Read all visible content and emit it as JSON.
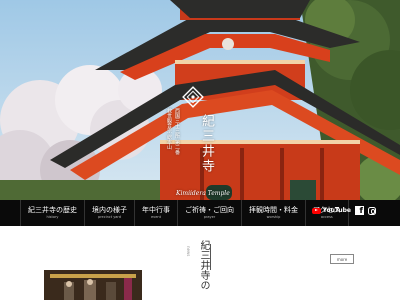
{
  "site": {
    "name": "紀三井寺",
    "romaji": "Kimiidera Temple",
    "tagline_1": "西国三十三所 第二番",
    "tagline_2": "救世観音宗 総本山"
  },
  "nav": {
    "items": [
      {
        "label": "紀三井寺の歴史",
        "en": "history"
      },
      {
        "label": "境内の様子",
        "en": "precinct yard"
      },
      {
        "label": "年中行事",
        "en": "event"
      },
      {
        "label": "ご祈祷・ご回向",
        "en": "prayer"
      },
      {
        "label": "拝観時間・料金",
        "en": "worship"
      },
      {
        "label": "アクセス",
        "en": "access"
      }
    ]
  },
  "social": {
    "youtube_label": "YouTube",
    "facebook_glyph": "f",
    "youtube_color": "#ff0000"
  },
  "section": {
    "title": "紀三井寺の",
    "subtitle": "news",
    "more_label": "more"
  },
  "colors": {
    "temple_red": "#d8401c",
    "nav_bg": "#0a0a0a"
  }
}
